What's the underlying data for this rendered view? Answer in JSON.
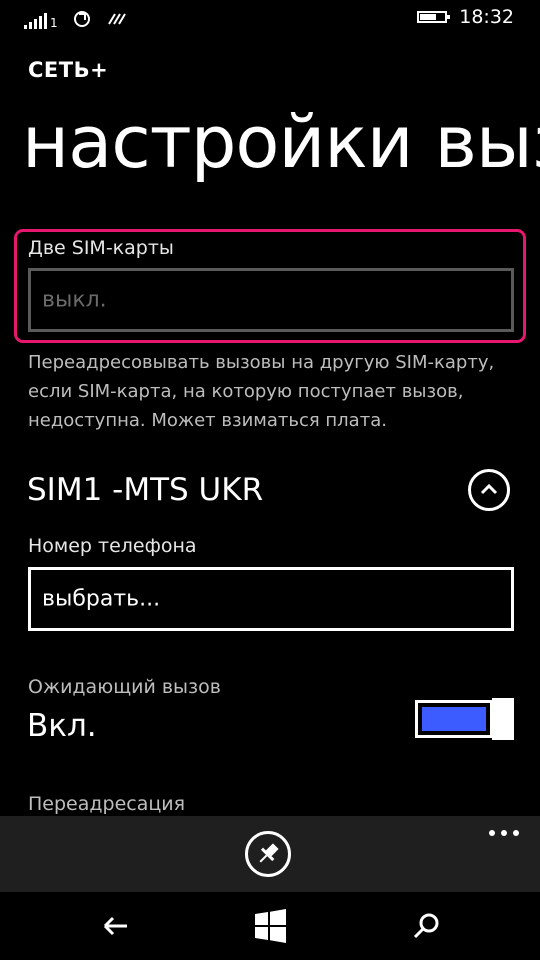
{
  "status_bar": {
    "time": "18:32",
    "signal_icon": "signal-strength-icon",
    "network_type": "1",
    "icons": [
      "data-sync-icon",
      "nfc-icon"
    ],
    "battery_level": 0.72
  },
  "header": {
    "app_title": "СЕТЬ+",
    "page_title": "настройки выз"
  },
  "dual_sim": {
    "label": "Две SIM-карты",
    "value": "выкл.",
    "description": "Переадресовывать вызовы на другую SIM-карту, если SIM-карта, на которую поступает вызов, недоступна. Может взиматься плата."
  },
  "sim1": {
    "title": "SIM1 -MTS UKR",
    "collapse_icon": "chevron-up-icon",
    "phone_label": "Номер телефона",
    "phone_value": "выбрать...",
    "call_waiting_label": "Ожидающий вызов",
    "call_waiting_value": "Вкл.",
    "call_waiting_on": true,
    "forwarding_label": "Переадресация"
  },
  "app_bar": {
    "pin_icon": "pin-icon",
    "more_icon": "more-icon"
  },
  "nav_bar": {
    "back_icon": "back-arrow-icon",
    "start_icon": "windows-start-icon",
    "search_icon": "search-icon"
  },
  "colors": {
    "accent_focus": "#e5176f",
    "toggle_on": "#3d5cff",
    "app_bar_bg": "#1f1f1f"
  }
}
